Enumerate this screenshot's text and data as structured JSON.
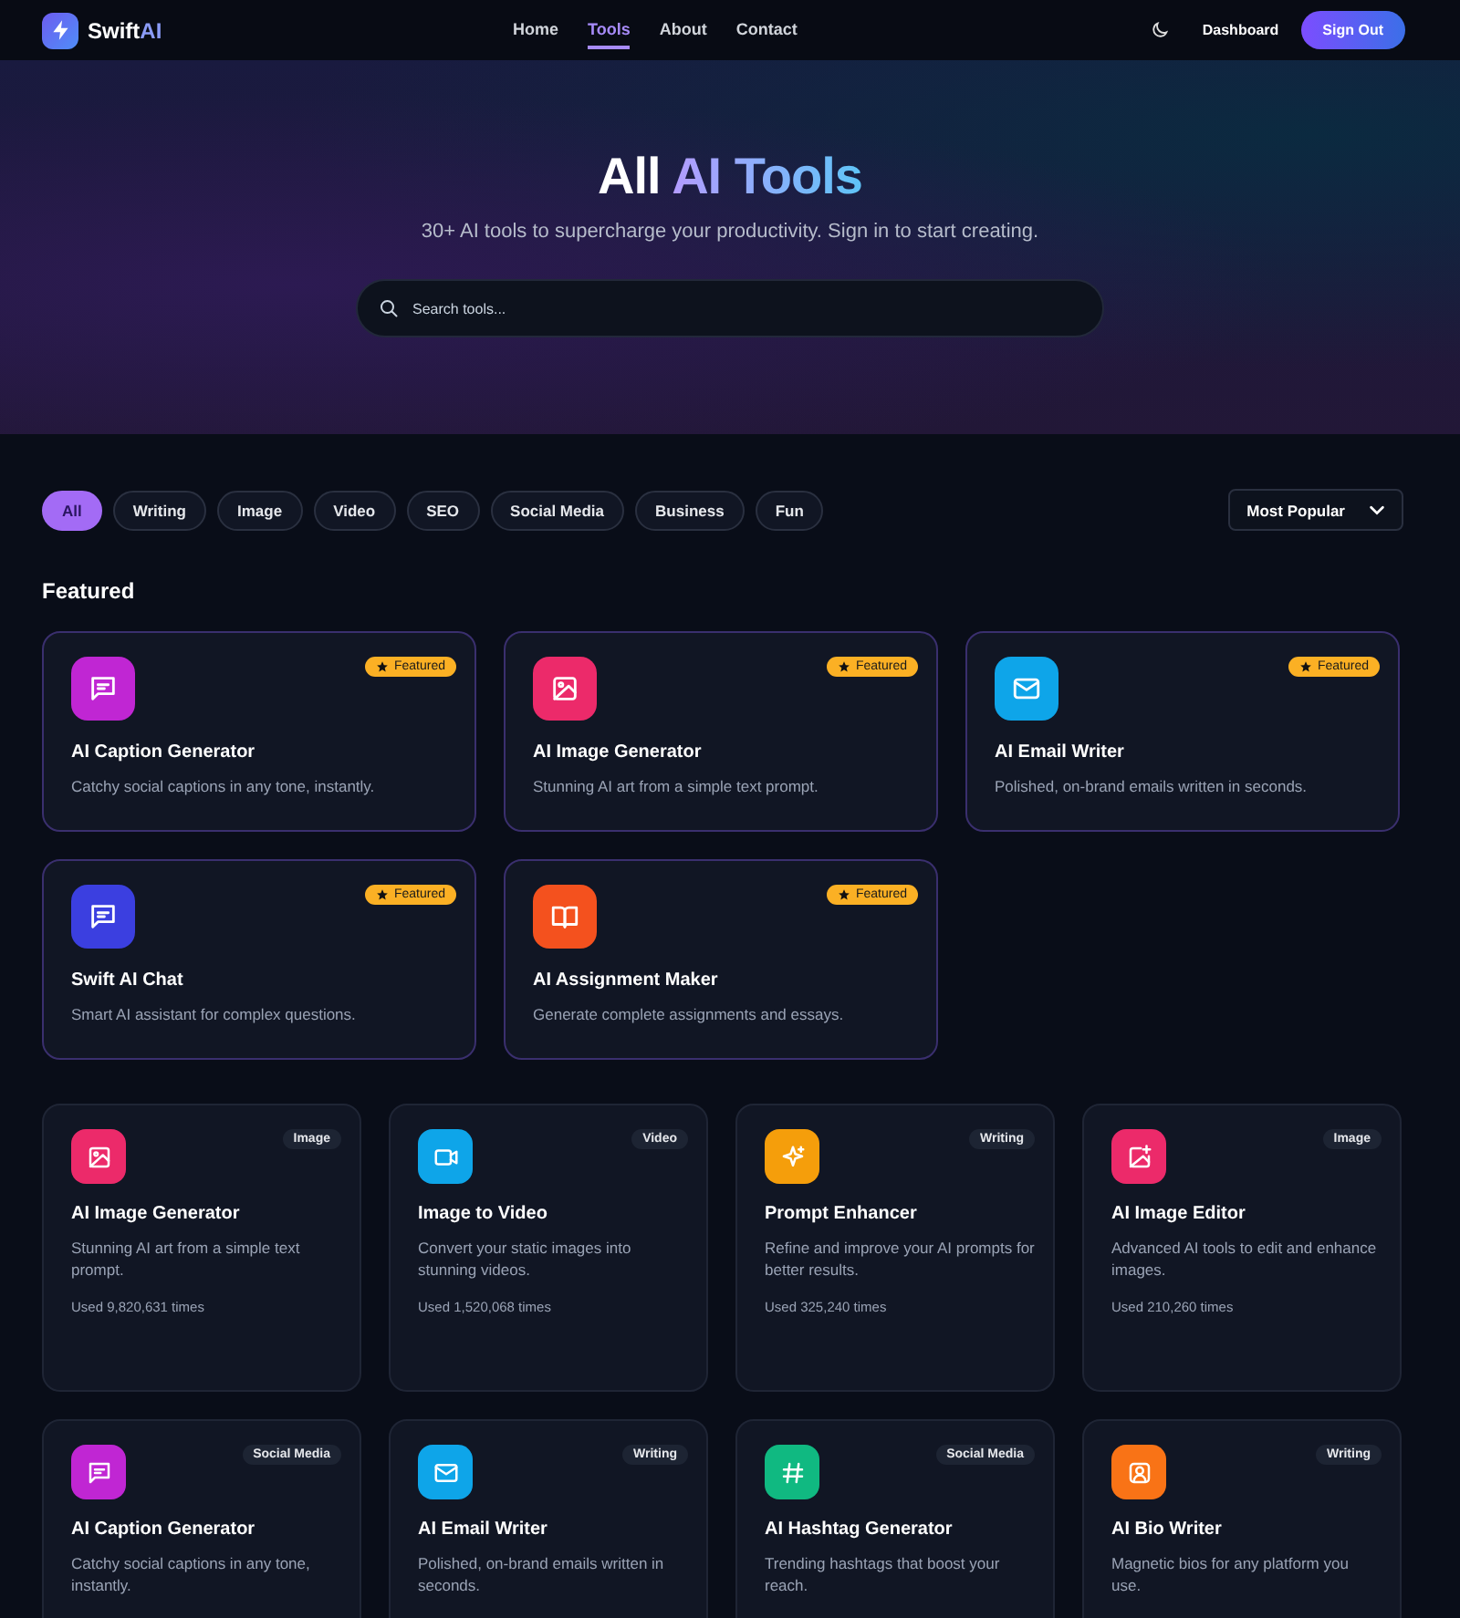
{
  "nav": {
    "brand": {
      "name": "Swift",
      "accent": "AI"
    },
    "links": [
      {
        "label": "Home",
        "selected": false
      },
      {
        "label": "Tools",
        "selected": true
      },
      {
        "label": "About",
        "selected": false
      },
      {
        "label": "Contact",
        "selected": false
      }
    ],
    "dashboard": "Dashboard",
    "sign_out": "Sign Out"
  },
  "hero": {
    "title_plain": "All",
    "title_accent": "AI Tools",
    "subtitle": "30+ AI tools to supercharge your productivity. Sign in to start creating.",
    "search": {
      "placeholder": "Search tools..."
    }
  },
  "filters": [
    {
      "label": "All",
      "selected": true
    },
    {
      "label": "Writing",
      "selected": false
    },
    {
      "label": "Image",
      "selected": false
    },
    {
      "label": "Video",
      "selected": false
    },
    {
      "label": "SEO",
      "selected": false
    },
    {
      "label": "Social Media",
      "selected": false
    },
    {
      "label": "Business",
      "selected": false
    },
    {
      "label": "Fun",
      "selected": false
    }
  ],
  "sort": {
    "value": "Most Popular"
  },
  "featured": {
    "heading": "Featured",
    "items": [
      {
        "kind": "chat",
        "color": "#c026d3",
        "badge": "Featured",
        "title": "AI Caption Generator",
        "desc": "Catchy social captions in any tone, instantly."
      },
      {
        "kind": "image",
        "color": "#ec2a6a",
        "badge": "Featured",
        "title": "AI Image Generator",
        "desc": "Stunning AI art from a simple text prompt."
      },
      {
        "kind": "mail",
        "color": "#0ea5e9",
        "badge": "Featured",
        "title": "AI Email Writer",
        "desc": "Polished, on-brand emails written in seconds."
      },
      {
        "kind": "chat",
        "color": "#3b3fe0",
        "badge": "Featured",
        "title": "Swift AI Chat",
        "desc": "Smart AI assistant for complex questions."
      },
      {
        "kind": "book",
        "color": "#f4511e",
        "badge": "Featured",
        "title": "AI Assignment Maker",
        "desc": "Generate complete assignments and essays."
      }
    ]
  },
  "tools": [
    {
      "kind": "image",
      "color": "#ec2a6a",
      "tag": "Image",
      "title": "AI Image Generator",
      "desc": "Stunning AI art from a simple text prompt.",
      "usage": "Used 9,820,631 times"
    },
    {
      "kind": "video",
      "color": "#0ea5e9",
      "tag": "Video",
      "title": "Image to Video",
      "desc": "Convert your static images into stunning videos.",
      "usage": "Used 1,520,068 times"
    },
    {
      "kind": "sparkle",
      "color": "#f59e0b",
      "tag": "Writing",
      "title": "Prompt Enhancer",
      "desc": "Refine and improve your AI prompts for better results.",
      "usage": "Used 325,240 times"
    },
    {
      "kind": "image-plus",
      "color": "#ec2a6a",
      "tag": "Image",
      "title": "AI Image Editor",
      "desc": "Advanced AI tools to edit and enhance images.",
      "usage": "Used 210,260 times"
    },
    {
      "kind": "chat",
      "color": "#c026d3",
      "tag": "Social Media",
      "title": "AI Caption Generator",
      "desc": "Catchy social captions in any tone, instantly."
    },
    {
      "kind": "mail",
      "color": "#0ea5e9",
      "tag": "Writing",
      "title": "AI Email Writer",
      "desc": "Polished, on-brand emails written in seconds."
    },
    {
      "kind": "hash",
      "color": "#10b981",
      "tag": "Social Media",
      "title": "AI Hashtag Generator",
      "desc": "Trending hashtags that boost your reach."
    },
    {
      "kind": "user",
      "color": "#f97316",
      "tag": "Writing",
      "title": "AI Bio Writer",
      "desc": "Magnetic bios for any platform you use."
    }
  ]
}
